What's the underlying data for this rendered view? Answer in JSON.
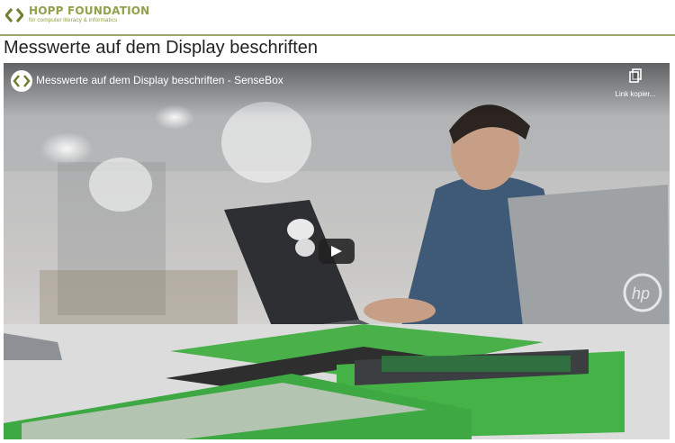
{
  "header": {
    "brand_name": "HOPP FOUNDATION",
    "brand_tagline": "for computer literacy & informatics",
    "brand_color": "#8fa14a"
  },
  "page": {
    "title": "Messwerte auf dem Display beschriften"
  },
  "video": {
    "title": "Messwerte auf dem Display beschriften - SenseBox",
    "copy_link_label": "Link kopier...",
    "copy_icon": "copy-icon",
    "play_icon": "play-icon"
  }
}
